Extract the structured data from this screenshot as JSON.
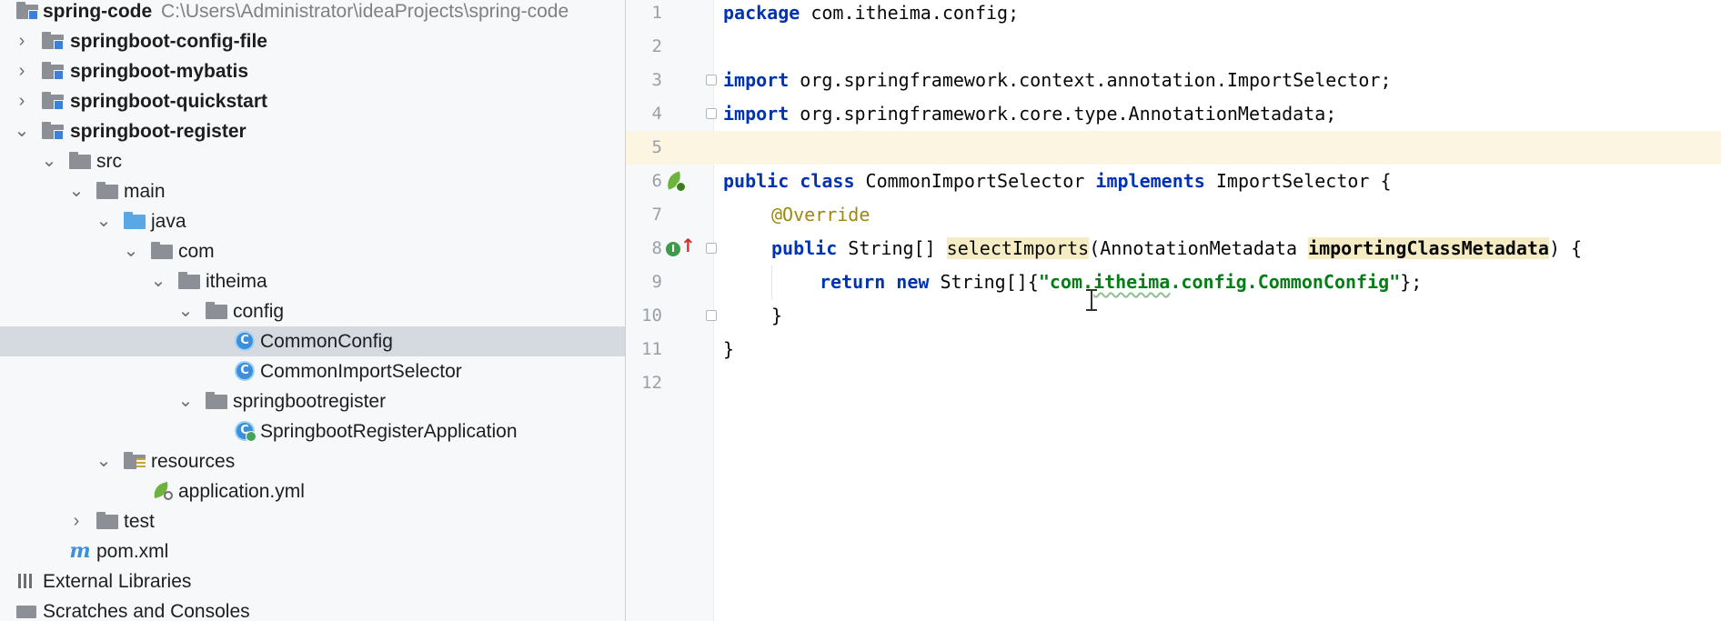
{
  "project_tree": {
    "root": {
      "label": "spring-code",
      "path": "C:\\Users\\Administrator\\ideaProjects\\spring-code"
    },
    "nodes": [
      {
        "label": "springboot-config-file"
      },
      {
        "label": "springboot-mybatis"
      },
      {
        "label": "springboot-quickstart"
      },
      {
        "label": "springboot-register"
      },
      {
        "label": "src"
      },
      {
        "label": "main"
      },
      {
        "label": "java"
      },
      {
        "label": "com"
      },
      {
        "label": "itheima"
      },
      {
        "label": "config"
      },
      {
        "label": "CommonConfig"
      },
      {
        "label": "CommonImportSelector"
      },
      {
        "label": "springbootregister"
      },
      {
        "label": "SpringbootRegisterApplication"
      },
      {
        "label": "resources"
      },
      {
        "label": "application.yml"
      },
      {
        "label": "test"
      },
      {
        "label": "pom.xml"
      },
      {
        "label": "External Libraries"
      },
      {
        "label": "Scratches and Consoles"
      }
    ],
    "selected": "CommonConfig"
  },
  "icons": {
    "expanded": "chevron-down-icon",
    "collapsed": "chevron-right-icon",
    "class_glyph": "C",
    "implements_glyph": "I",
    "implements_arrow": "↑",
    "expanded_glyph": "⌄",
    "collapsed_glyph": "›"
  },
  "editor": {
    "line_numbers": [
      "1",
      "2",
      "3",
      "4",
      "5",
      "6",
      "7",
      "8",
      "9",
      "10",
      "11",
      "12"
    ],
    "current_line": "5",
    "lines": {
      "l1": {
        "kw": "package",
        "rest": " com.itheima.config;"
      },
      "l3": {
        "kw": "import",
        "rest": " org.springframework.context.annotation.ImportSelector;"
      },
      "l4": {
        "kw": "import",
        "rest": " org.springframework.core.type.AnnotationMetadata;"
      },
      "l6": {
        "kw1": "public",
        "kw2": "class",
        "name": " CommonImportSelector ",
        "kw3": "implements",
        "rest": " ImportSelector {"
      },
      "l7": {
        "annotation": "@Override"
      },
      "l8": {
        "kw1": "public",
        "type": " String[] ",
        "method": "selectImports",
        "param_type": "(AnnotationMetadata ",
        "param": "importingClassMetadata",
        "rest": ") {"
      },
      "l9": {
        "kw1": "return",
        "kw2": "new",
        "type": " String[]{",
        "str_q1": "\"",
        "str_a": "com.",
        "str_b": "itheima",
        "str_c": ".config.CommonConfig",
        "str_q2": "\"",
        "rest": "};"
      },
      "l10": {
        "text": "}"
      },
      "l11": {
        "text": "}"
      }
    }
  },
  "colors": {
    "keyword": "#0033b3",
    "string": "#067d17",
    "annotation": "#9e880d",
    "current_line": "#fcf5e1",
    "selection": "#d5d9e0"
  }
}
